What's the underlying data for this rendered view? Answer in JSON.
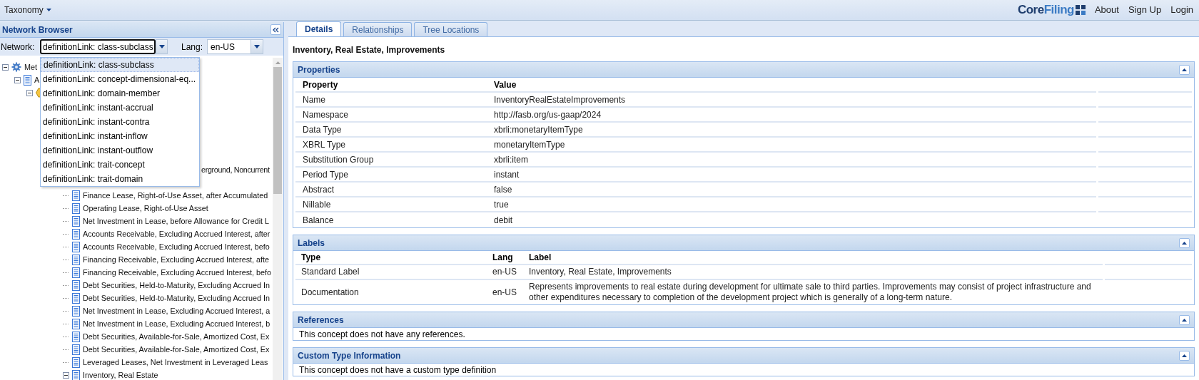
{
  "menu": {
    "label": "Taxonomy"
  },
  "logo": {
    "part_1": "Core",
    "part_2": "Filing"
  },
  "header_links": [
    "About",
    "Sign Up",
    "Login"
  ],
  "network_browser": {
    "title": "Network Browser",
    "network_label": "Network:",
    "network_value": "definitionLink: class-subclass",
    "lang_label": "Lang:",
    "lang_value": "en-US",
    "dropdown": [
      {
        "label": "definitionLink: class-subclass",
        "selected": true
      },
      {
        "label": "definitionLink: concept-dimensional-eq...",
        "selected": false
      },
      {
        "label": "definitionLink: domain-member",
        "selected": false
      },
      {
        "label": "definitionLink: instant-accrual",
        "selected": false
      },
      {
        "label": "definitionLink: instant-contra",
        "selected": false
      },
      {
        "label": "definitionLink: instant-inflow",
        "selected": false
      },
      {
        "label": "definitionLink: instant-outflow",
        "selected": false
      },
      {
        "label": "definitionLink: trait-concept",
        "selected": false
      },
      {
        "label": "definitionLink: trait-domain",
        "selected": false
      }
    ],
    "tree": [
      {
        "label": "Met",
        "kind": "gear",
        "expanded": true,
        "children": [
          {
            "label": "A",
            "kind": "concept",
            "expanded": true,
            "children": [
              {
                "kind": "group",
                "expanded": true,
                "children": [
                  {
                    "children": [
                      {
                        "children": [
                          {
                            "label": "erground, Noncurrent",
                            "kind": "covered"
                          },
                          {
                            "label": "Finance Lease, Right-of-Use Asset, after Accumulated",
                            "kind": "concept"
                          },
                          {
                            "label": "Operating Lease, Right-of-Use Asset",
                            "kind": "concept"
                          },
                          {
                            "label": "Net Investment in Lease, before Allowance for Credit L",
                            "kind": "concept"
                          },
                          {
                            "label": "Accounts Receivable, Excluding Accrued Interest, after",
                            "kind": "concept"
                          },
                          {
                            "label": "Accounts Receivable, Excluding Accrued Interest, befo",
                            "kind": "concept"
                          },
                          {
                            "label": "Financing Receivable, Excluding Accrued Interest, afte",
                            "kind": "concept"
                          },
                          {
                            "label": "Financing Receivable, Excluding Accrued Interest, befo",
                            "kind": "concept"
                          },
                          {
                            "label": "Debt Securities, Held-to-Maturity, Excluding Accrued In",
                            "kind": "concept"
                          },
                          {
                            "label": "Debt Securities, Held-to-Maturity, Excluding Accrued In",
                            "kind": "concept"
                          },
                          {
                            "label": "Net Investment in Lease, Excluding Accrued Interest, a",
                            "kind": "concept"
                          },
                          {
                            "label": "Net Investment in Lease, Excluding Accrued Interest, b",
                            "kind": "concept"
                          },
                          {
                            "label": "Debt Securities, Available-for-Sale, Amortized Cost, Ex",
                            "kind": "concept"
                          },
                          {
                            "label": "Debt Securities, Available-for-Sale, Amortized Cost, Ex",
                            "kind": "concept"
                          },
                          {
                            "label": "Leveraged Leases, Net Investment in Leveraged Leas",
                            "kind": "concept"
                          },
                          {
                            "label": "Inventory, Real Estate",
                            "kind": "concept",
                            "expanded": true
                          }
                        ]
                      }
                    ]
                  }
                ]
              }
            ]
          }
        ]
      }
    ]
  },
  "tabs": [
    {
      "label": "Details",
      "selected": true
    },
    {
      "label": "Relationships",
      "selected": false
    },
    {
      "label": "Tree Locations",
      "selected": false
    }
  ],
  "concept_title": "Inventory, Real Estate, Improvements",
  "properties": {
    "title": "Properties",
    "columns": [
      "Property",
      "Value"
    ],
    "rows": [
      [
        "Name",
        "InventoryRealEstateImprovements"
      ],
      [
        "Namespace",
        "http://fasb.org/us-gaap/2024"
      ],
      [
        "Data Type",
        "xbrli:monetaryItemType"
      ],
      [
        "XBRL Type",
        "monetaryItemType"
      ],
      [
        "Substitution Group",
        "xbrli:item"
      ],
      [
        "Period Type",
        "instant"
      ],
      [
        "Abstract",
        "false"
      ],
      [
        "Nillable",
        "true"
      ],
      [
        "Balance",
        "debit"
      ]
    ]
  },
  "labels": {
    "title": "Labels",
    "columns": [
      "Type",
      "Lang",
      "Label"
    ],
    "rows": [
      [
        "Standard Label",
        "en-US",
        "Inventory, Real Estate, Improvements"
      ],
      [
        "Documentation",
        "en-US",
        "Represents improvements to real estate during development for ultimate sale to third parties. Improvements may consist of project infrastructure and other expenditures necessary to completion of the development project which is generally of a long-term nature."
      ]
    ]
  },
  "references": {
    "title": "References",
    "message": "This concept does not have any references."
  },
  "custom_type": {
    "title": "Custom Type Information",
    "message": "This concept does not have a custom type definition"
  }
}
